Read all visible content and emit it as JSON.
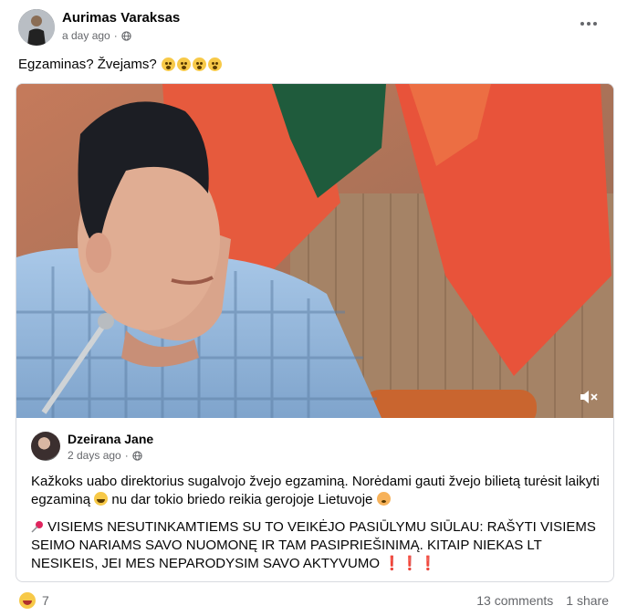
{
  "post": {
    "author": "Aurimas Varaksas",
    "timestamp": "a day ago",
    "privacy_icon": "globe-icon",
    "text": "Egzaminas? Žvejams?",
    "text_emojis": [
      "astonished-emoji",
      "astonished-emoji",
      "astonished-emoji",
      "astonished-emoji"
    ]
  },
  "shared": {
    "author": "Dzeirana Jane",
    "timestamp": "2 days ago",
    "privacy_icon": "globe-icon",
    "paragraph1_part1": "Kažkoks uabo direktorius sugalvojo žvejo egzaminą. Norėdami gauti žvejo bilietą turėsit laikyti egzaminą",
    "paragraph1_part2": " nu dar tokio briedo reikia gerojoje Lietuvoje",
    "paragraph2": "VISIEMS NESUTINKAMTIEMS SU TO VEIKĖJO PASIŪLYMU SIŪLAU: RAŠYTI VISIEMS SEIMO NARIAMS SAVO NUOMONĘ IR TAM PASIPRIEŠINIMĄ. KITAIP NIEKAS LT NESIKEIS, JEI MES NEPARODYSIM SAVO AKTYVUMO",
    "exclamations": "❗❗❗"
  },
  "footer": {
    "reaction_count": "7",
    "comments": "13 comments",
    "shares": "1 share"
  },
  "colors": {
    "secondary_text": "#65676b",
    "card_border": "#d8dadf",
    "flag_red": "#e8533a",
    "flag_green": "#1f5b3c",
    "flag_yellow": "#f2b705"
  }
}
